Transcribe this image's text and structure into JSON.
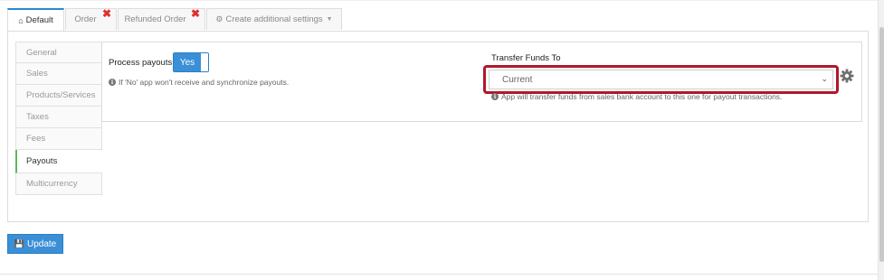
{
  "tabs": [
    {
      "label": "Default",
      "icon": "home-icon",
      "active": true
    },
    {
      "label": "Order",
      "closable": true
    },
    {
      "label": "Refunded Order",
      "closable": true
    },
    {
      "label": "Create additional settings",
      "icon": "gear-icon",
      "dropdown": true
    }
  ],
  "sidebar": {
    "items": [
      {
        "label": "General"
      },
      {
        "label": "Sales"
      },
      {
        "label": "Products/Services"
      },
      {
        "label": "Taxes"
      },
      {
        "label": "Fees"
      },
      {
        "label": "Payouts",
        "active": true
      },
      {
        "label": "Multicurrency"
      }
    ]
  },
  "payouts": {
    "process_label": "Process payouts",
    "toggle_value": "Yes",
    "process_help": "If 'No' app won't receive and synchronize payouts.",
    "transfer_label": "Transfer Funds To",
    "transfer_value": "Current",
    "transfer_help": "App will transfer funds from sales bank account to this one for payout transactions."
  },
  "actions": {
    "update_label": "Update"
  },
  "colors": {
    "primary": "#3a8fd6",
    "highlight": "#b0182b",
    "close": "#e0302c",
    "active_side": "#5cb85c"
  }
}
